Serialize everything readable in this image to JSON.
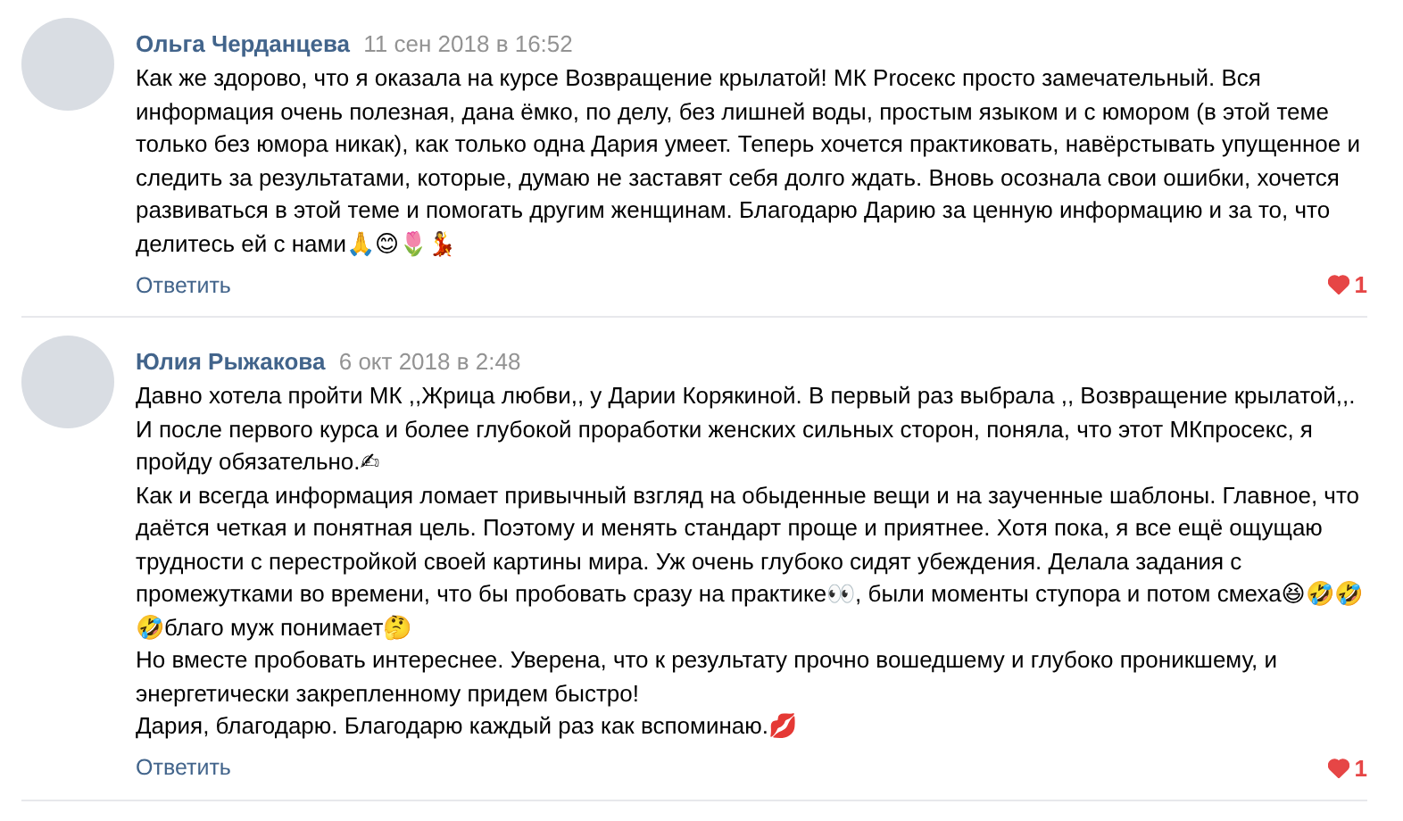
{
  "comments": [
    {
      "author": "Ольга Черданцева",
      "date": "11 сен 2018 в 16:52",
      "text": "Как же здорово, что я оказала на курсе Возвращение крылатой! МК Procекс просто замечательный. Вся информация очень полезная, дана ёмко, по делу, без лишней воды, простым языком и с юмором (в этой теме только без юмора никак), как только одна Дария умеет. Теперь хочется практиковать, навёрстывать упущенное и следить за результатами, которые, думаю не заставят себя долго ждать. Вновь осознала свои ошибки, хочется развиваться в этой теме и помогать другим женщинам. Благодарю Дарию за ценную информацию и за то, что делитесь ей с нами🙏😊🌷💃",
      "reply": "Ответить",
      "liked": true,
      "likes": "1"
    },
    {
      "author": "Юлия Рыжакова",
      "date": "6 окт 2018 в 2:48",
      "text": "Давно хотела пройти МК ,,Жрица любви,, у Дарии Корякиной. В первый раз выбрала ,, Возвращение крылатой,,. И после первого курса и более глубокой проработки женских сильных сторон, поняла, что этот МКпросекс, я пройду обязательно.✍\nКак и всегда информация ломает привычный взгляд на обыденные вещи и на заученные шаблоны. Главное, что даётся четкая и понятная цель. Поэтому и менять стандарт проще и приятнее. Хотя пока, я все ещё ощущаю трудности с перестройкой своей картины мира. Уж очень глубоко сидят убеждения. Делала задания с промежутками во времени, что бы пробовать сразу на практике👀, были моменты ступора и потом смеха😆🤣🤣🤣благо муж понимает🤔\nНо вместе пробовать интереснее. Уверена, что к результату прочно вошедшему и глубоко проникшему, и энергетически закрепленному придем быстро!\nДария, благодарю. Благодарю каждый раз как вспоминаю.💋",
      "reply": "Ответить",
      "liked": true,
      "likes": "1"
    }
  ]
}
